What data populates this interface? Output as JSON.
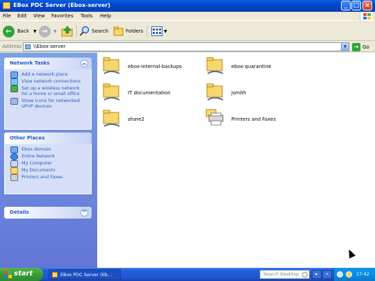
{
  "window": {
    "title": "EBox PDC Server (Ebox-server)"
  },
  "menubar": {
    "items": [
      "File",
      "Edit",
      "View",
      "Favorites",
      "Tools",
      "Help"
    ]
  },
  "toolbar": {
    "back_label": "Back",
    "search_label": "Search",
    "folders_label": "Folders"
  },
  "addressbar": {
    "label": "Address",
    "value": "\\\\Ebox-server",
    "go_label": "Go"
  },
  "leftpane": {
    "network_tasks": {
      "title": "Network Tasks",
      "items": [
        "Add a network place",
        "View network connections",
        "Set up a wireless network for a home or small office",
        "Show icons for networked UPnP devices"
      ]
    },
    "other_places": {
      "title": "Other Places",
      "items": [
        "Ebox-domain",
        "Entire Network",
        "My Computer",
        "My Documents",
        "Printers and Faxes"
      ]
    },
    "details": {
      "title": "Details"
    }
  },
  "content": {
    "items": [
      "ebox-internal-backups",
      "ebox-quarantine",
      "IT documentation",
      "jsmith",
      "share2",
      "Printers and Faxes"
    ]
  },
  "taskbar": {
    "start_label": "start",
    "task_label": "EBox PDC Server (Eb...",
    "search_placeholder": "Search Desktop",
    "clock": "17:42"
  },
  "colors": {
    "titlebar": "#0a5fdc",
    "leftpane": "#7ba2e7",
    "link": "#215dc6",
    "start": "#369c36"
  }
}
